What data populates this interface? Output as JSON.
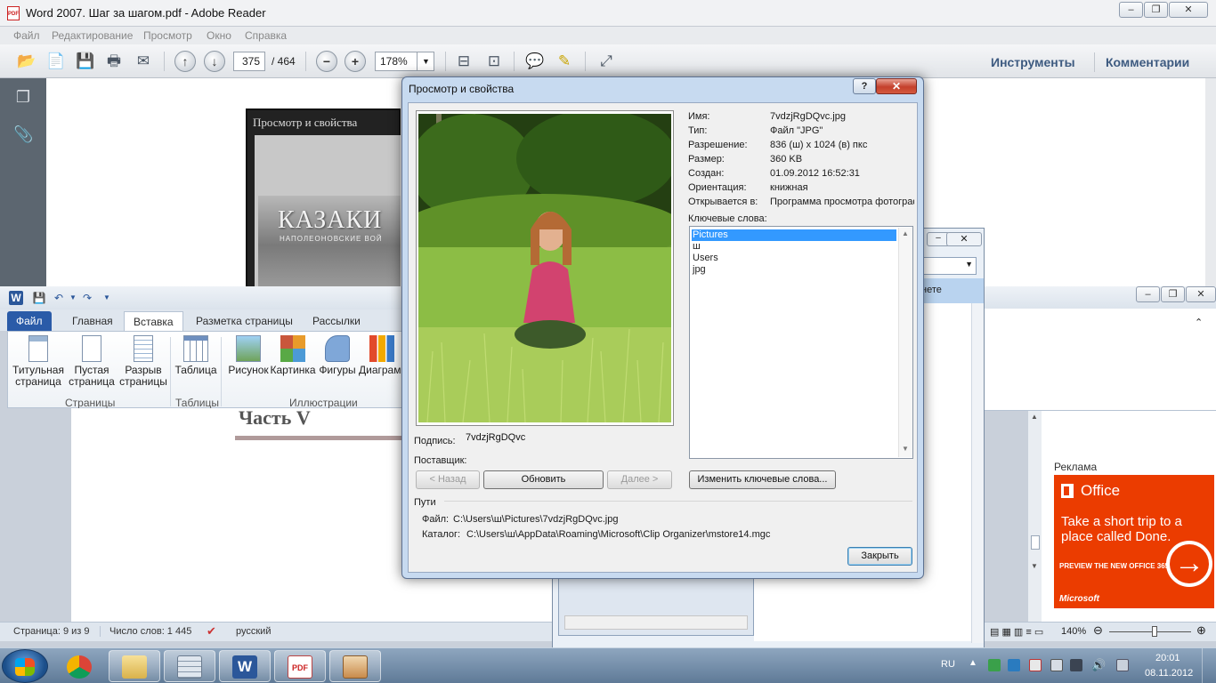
{
  "reader": {
    "title": "Word 2007. Шаг за шагом.pdf - Adobe Reader",
    "pdf_icon": "PDF",
    "menu": [
      "Файл",
      "Редактирование",
      "Просмотр",
      "Окно",
      "Справка"
    ],
    "page_current": "375",
    "page_total": "/ 464",
    "zoom": "178%",
    "tools_link": "Инструменты",
    "comments_link": "Комментарии",
    "inner_dialog_title": "Просмотр и свойства",
    "inner_image_title": "КАЗАКИ",
    "inner_image_subtitle": "НАПОЛЕОНОВСКИЕ ВОЙ"
  },
  "word": {
    "tabs": [
      "Файл",
      "Главная",
      "Вставка",
      "Разметка страницы",
      "Рассылки"
    ],
    "ribbon": {
      "title_page": "Титульная\nстраница",
      "blank_page": "Пустая\nстраница",
      "page_break": "Разрыв\nстраницы",
      "table": "Таблица",
      "picture": "Рисунок",
      "clipart": "Картинка",
      "shapes": "Фигуры",
      "chart": "Диаграм",
      "group_pages": "Страницы",
      "group_tables": "Таблицы",
      "group_illustrations": "Иллюстрации"
    },
    "doc_heading": "Часть V",
    "status": {
      "page": "Страница: 9 из 9",
      "words": "Число слов: 1 445",
      "language": "русский",
      "zoom": "140%"
    },
    "ad_label": "Реклама",
    "ad": {
      "brand": "Office",
      "headline": "Take a short trip to a place called Done.",
      "cta": "PREVIEW THE NEW OFFICE 365",
      "maker": "Microsoft",
      "color": "#eb3c00"
    }
  },
  "clip_organizer": {
    "partial_text": "нете"
  },
  "dialog": {
    "title": "Просмотр и свойства",
    "help": "?",
    "close": "✕",
    "props": [
      {
        "label": "Имя:",
        "value": "7vdzjRgDQvc.jpg"
      },
      {
        "label": "Тип:",
        "value": "Файл \"JPG\""
      },
      {
        "label": "Разрешение:",
        "value": "836 (ш) x 1024 (в) пкс"
      },
      {
        "label": "Размер:",
        "value": "360 KB"
      },
      {
        "label": "Создан:",
        "value": "01.09.2012 16:52:31"
      },
      {
        "label": "Ориентация:",
        "value": "книжная"
      },
      {
        "label": "Открывается в:",
        "value": "Программа просмотра фотограф"
      }
    ],
    "keywords_label": "Ключевые слова:",
    "keywords": [
      "Pictures",
      "ш",
      "Users",
      "jpg"
    ],
    "caption_label": "Подпись:",
    "caption_value": "7vdzjRgDQvc",
    "provider_label": "Поставщик:",
    "back_button": "< Назад",
    "refresh_button": "Обновить",
    "next_button": "Далее >",
    "change_keywords_button": "Изменить ключевые слова...",
    "paths_label": "Пути",
    "file_label": "Файл:",
    "file_path": "C:\\Users\\ш\\Pictures\\7vdzjRgDQvc.jpg",
    "catalog_label": "Каталог:",
    "catalog_path": "C:\\Users\\ш\\AppData\\Roaming\\Microsoft\\Clip Organizer\\mstore14.mgc",
    "close_button": "Закрыть"
  },
  "taskbar": {
    "apps": [
      "chrome-icon",
      "explorer-icon",
      "calculator-icon",
      "word-icon",
      "pdf-icon",
      "user-icon"
    ],
    "word_letter": "W",
    "pdf_badge": "PDF",
    "lang": "RU",
    "time": "20:01",
    "date": "08.11.2012"
  }
}
